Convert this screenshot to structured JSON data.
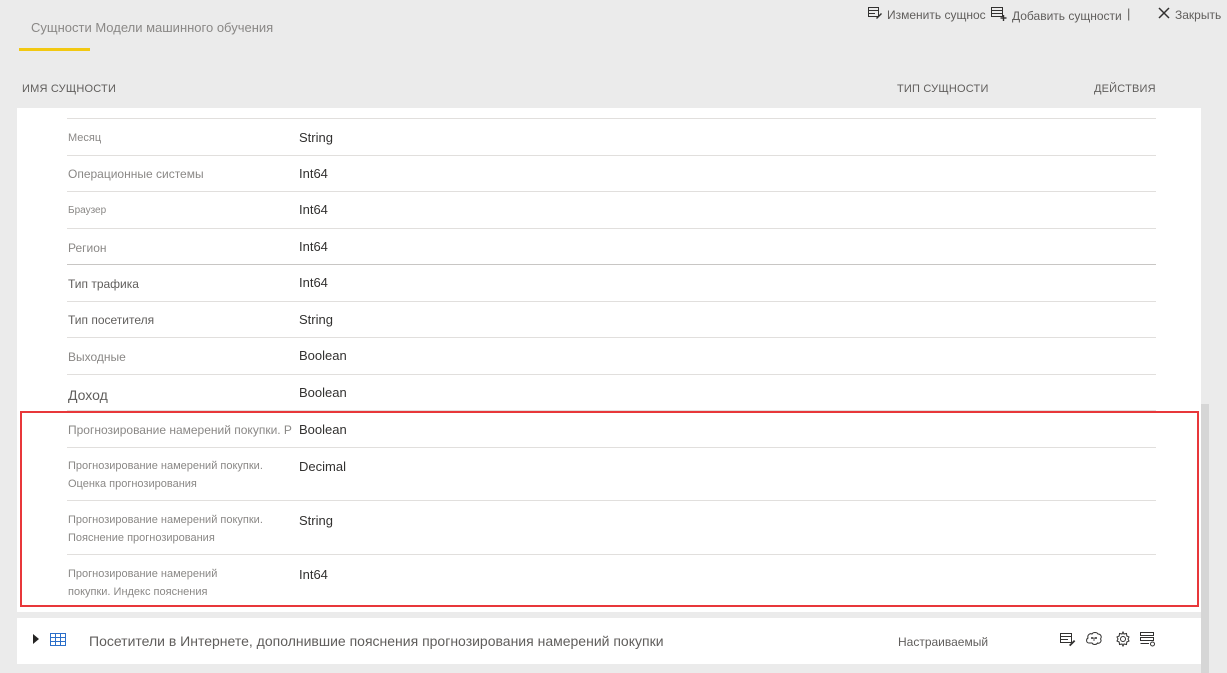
{
  "tab": {
    "label": "Сущности Модели машинного обучения"
  },
  "toolbar": {
    "edit_label": "Изменить сущнос",
    "add_label": "Добавить сущности",
    "separator": "|",
    "close_label": "Закрыть"
  },
  "columns": {
    "name": "ИМЯ СУЩНОСТИ",
    "type": "ТИП СУЩНОСТИ",
    "actions": "ДЕЙСТВИЯ"
  },
  "rows": [
    {
      "name": "Месяц",
      "type": "String"
    },
    {
      "name": "Операционные системы",
      "type": "Int64"
    },
    {
      "name": "Браузер",
      "type": "Int64"
    },
    {
      "name": "Регион",
      "type": "Int64"
    },
    {
      "name": "Тип трафика",
      "type": "Int64"
    },
    {
      "name": "Тип посетителя",
      "type": "String"
    },
    {
      "name": "Выходные",
      "type": "Boolean"
    },
    {
      "name": "Доход",
      "type": "Boolean"
    },
    {
      "name": "Прогнозирование намерений покупки. P",
      "type": "Boolean"
    },
    {
      "name": "Прогнозирование намерений покупки. Оценка прогнозирования",
      "type": "Decimal"
    },
    {
      "name": "Прогнозирование намерений покупки. Пояснение прогнозирования",
      "type": "String"
    },
    {
      "name": "Прогнозирование намерений покупки. Индекс пояснения",
      "type": "Int64"
    }
  ],
  "entity": {
    "title": "Посетители в Интернете, дополнившие пояснения прогнозирования намерений покупки",
    "type": "Настраиваемый"
  },
  "icons": {
    "edit": "edit-table-icon",
    "add": "add-table-icon",
    "close": "close-icon",
    "table": "table-icon",
    "ml": "brain-icon",
    "settings": "gear-icon",
    "more": "server-list-icon"
  },
  "colors": {
    "accent": "#f2c811",
    "highlight": "#e8373a"
  }
}
